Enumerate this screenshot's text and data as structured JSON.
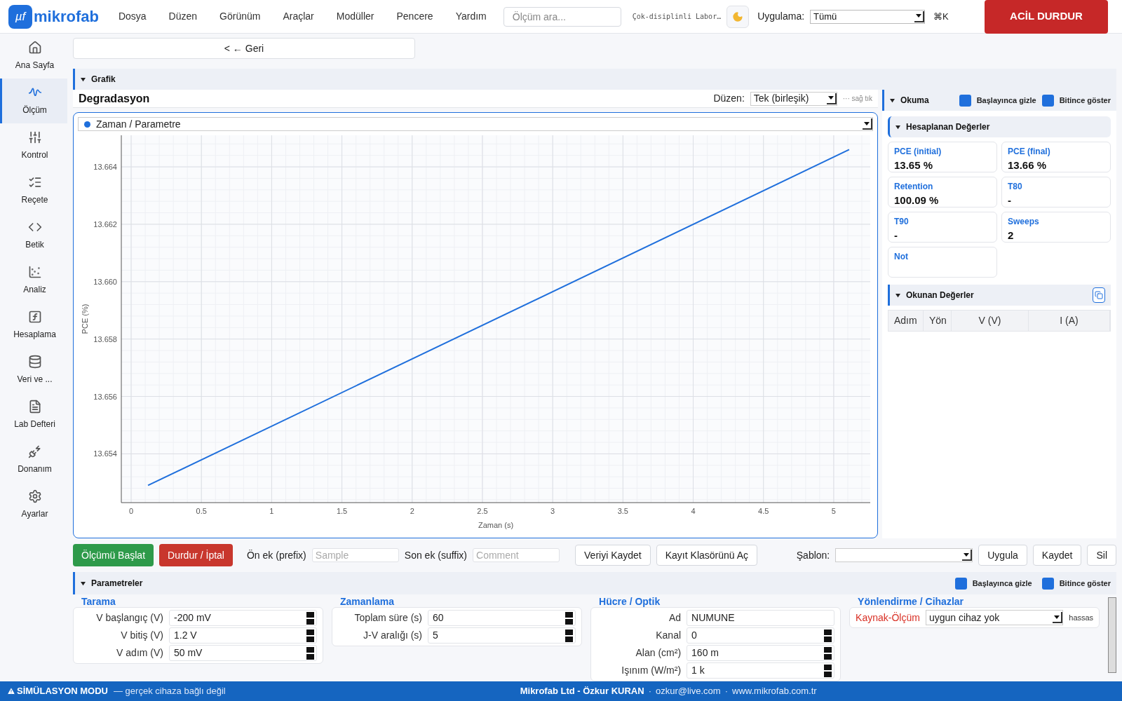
{
  "app": {
    "logo_mark": "µf",
    "logo_text": "mikrofab"
  },
  "menu": [
    "Dosya",
    "Düzen",
    "Görünüm",
    "Araçlar",
    "Modüller",
    "Pencere",
    "Yardım"
  ],
  "search": {
    "placeholder": "Ölçüm ara..."
  },
  "lab_name": "Çok-disiplinli Labor…",
  "app_filter": {
    "label": "Uygulama:",
    "value": "Tümü"
  },
  "shortcut": "⌘K",
  "emergency_button": "ACİL DURDUR",
  "sidebar": {
    "items": [
      {
        "label": "Ana Sayfa",
        "selected": false
      },
      {
        "label": "Ölçüm",
        "selected": true
      },
      {
        "label": "Kontrol",
        "selected": false
      },
      {
        "label": "Reçete",
        "selected": false
      },
      {
        "label": "Betik",
        "selected": false
      },
      {
        "label": "Analiz",
        "selected": false
      },
      {
        "label": "Hesaplama",
        "selected": false
      },
      {
        "label": "Veri ve ...",
        "selected": false
      },
      {
        "label": "Lab Defteri",
        "selected": false
      },
      {
        "label": "Donanım",
        "selected": false
      },
      {
        "label": "Ayarlar",
        "selected": false
      }
    ]
  },
  "back_button": "< ← Geri",
  "graph_section": {
    "title": "Grafik",
    "expanded": true
  },
  "chart_panel": {
    "title": "Degradasyon",
    "layout_label": "Düzen:",
    "layout_value": "Tek (birleşik)",
    "hint": "··· sağ tık",
    "series_selector": "Zaman / Parametre",
    "chart_data": {
      "type": "line",
      "xlabel": "Zaman (s)",
      "ylabel": "PCE (%)",
      "xlim": [
        -0.07,
        5.26
      ],
      "ylim": [
        13.6523,
        13.6651
      ],
      "xticks": [
        0,
        0.5,
        1,
        1.5,
        2,
        2.5,
        3,
        3.5,
        4,
        4.5,
        5
      ],
      "yticks": [
        13.654,
        13.656,
        13.658,
        {
          "value": 13.66,
          "label": "13.660"
        },
        13.662,
        13.664
      ],
      "grid": true,
      "x": [
        0.12,
        5.11
      ],
      "series": [
        {
          "color": "#1f6fdc",
          "values": [
            13.6529,
            13.6646
          ]
        }
      ]
    }
  },
  "reading": {
    "title": "Okuma",
    "expanded": true,
    "toggles": [
      {
        "label": "Başlayınca gizle",
        "checked": true
      },
      {
        "label": "Bitince göster",
        "checked": true
      }
    ],
    "computed": {
      "title": "Hesaplanan Değerler",
      "expanded": true,
      "cards": [
        {
          "label": "PCE (initial)",
          "value": "13.65 %"
        },
        {
          "label": "PCE (final)",
          "value": "13.66 %"
        },
        {
          "label": "Retention",
          "value": "100.09 %"
        },
        {
          "label": "T80",
          "value": "-"
        },
        {
          "label": "T90",
          "value": "-"
        },
        {
          "label": "Sweeps",
          "value": "2"
        },
        {
          "label": "Not"
        }
      ]
    },
    "readings": {
      "title": "Okunan Değerler",
      "expanded": true,
      "columns": [
        "Adım",
        "Yön",
        "V (V)",
        "I (A)"
      ]
    }
  },
  "actions": {
    "start_button": "Ölçümü Başlat",
    "stop_button": "Durdur / İptal",
    "prefix": {
      "label": "Ön ek (prefix)",
      "placeholder": "Sample"
    },
    "suffix": {
      "label": "Son ek (suffix)",
      "placeholder": "Comment"
    },
    "save_button": "Veriyi Kaydet",
    "folder_button": "Kayıt Klasörünü Aç",
    "template": {
      "label": "Şablon:"
    },
    "template_buttons": [
      "Uygula",
      "Kaydet",
      "Sil"
    ]
  },
  "parameters": {
    "title": "Parametreler",
    "expanded": true,
    "toggles": [
      {
        "label": "Başlayınca gizle",
        "checked": true
      },
      {
        "label": "Bitince göster",
        "checked": true
      }
    ],
    "groups": [
      {
        "title": "Tarama",
        "fields": [
          {
            "label": "V başlangıç (V)",
            "value": "-200 mV",
            "kind": "spin"
          },
          {
            "label": "V bitiş (V)",
            "value": "1.2 V",
            "kind": "spin"
          },
          {
            "label": "V adım (V)",
            "value": "50 mV",
            "kind": "spin"
          }
        ]
      },
      {
        "title": "Zamanlama",
        "fields": [
          {
            "label": "Toplam süre (s)",
            "value": "60",
            "kind": "spin"
          },
          {
            "label": "J-V aralığı (s)",
            "value": "5",
            "kind": "spin"
          }
        ]
      },
      {
        "title": "Hücre / Optik",
        "fields": [
          {
            "label": "Ad",
            "value": "NUMUNE",
            "kind": "text"
          },
          {
            "label": "Kanal",
            "value": "0",
            "kind": "spin"
          },
          {
            "label": "Alan (cm²)",
            "value": "160 m",
            "kind": "spin"
          },
          {
            "label": "Işınım (W/m²)",
            "value": "1 k",
            "kind": "spin"
          }
        ]
      },
      {
        "title": "Yönlendirme / Cihazlar",
        "fields": [
          {
            "label": "Kaynak-Ölçüm",
            "value": "uygun cihaz yok",
            "kind": "select",
            "warning": true,
            "note": "hassas"
          }
        ]
      }
    ]
  },
  "footer": {
    "mode": "SİMÜLASYON MODU",
    "mode_note": "— gerçek cihaza bağlı değil",
    "separator": "·",
    "credits": [
      "Mikrofab Ltd - Özkur KURAN",
      "ozkur@live.com",
      "www.mikrofab.com.tr"
    ]
  }
}
